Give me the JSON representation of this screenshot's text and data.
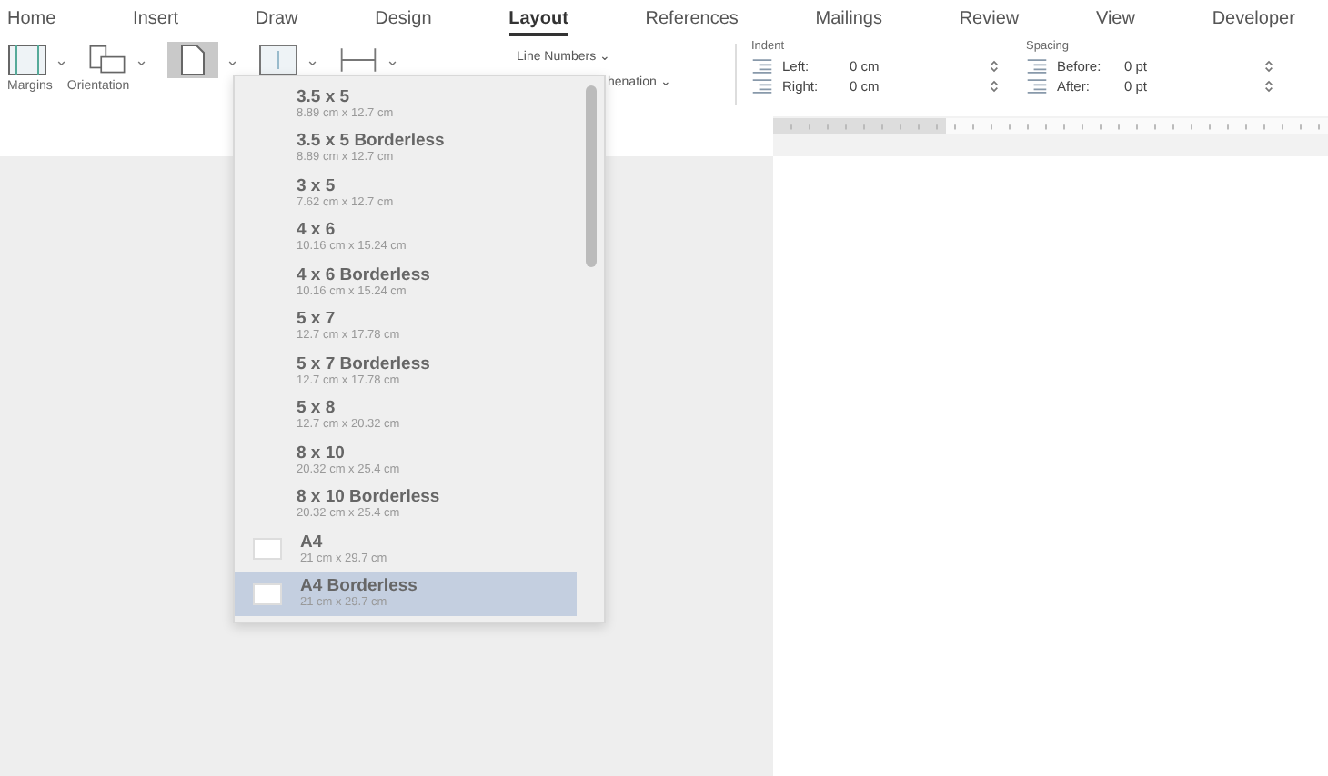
{
  "tabs": [
    {
      "label": "Home",
      "selected": false
    },
    {
      "label": "Insert",
      "selected": false
    },
    {
      "label": "Draw",
      "selected": false
    },
    {
      "label": "Design",
      "selected": false
    },
    {
      "label": "Layout",
      "selected": true
    },
    {
      "label": "References",
      "selected": false
    },
    {
      "label": "Mailings",
      "selected": false
    },
    {
      "label": "Review",
      "selected": false
    },
    {
      "label": "View",
      "selected": false
    },
    {
      "label": "Developer",
      "selected": false
    }
  ],
  "ribbon": {
    "margins_label": "Margins",
    "orientation_label": "Orientation",
    "size_pressed": true,
    "line_numbers": "Line Numbers",
    "hyphenation_partial": "henation",
    "caret": "⌄",
    "indent": {
      "title": "Indent",
      "fields": [
        {
          "label": "Left:",
          "value": "0 cm"
        },
        {
          "label": "Right:",
          "value": "0 cm"
        }
      ]
    },
    "spacing": {
      "title": "Spacing",
      "fields": [
        {
          "label": "Before:",
          "value": "0 pt"
        },
        {
          "label": "After:",
          "value": "0 pt"
        }
      ]
    }
  },
  "size_menu": {
    "items": [
      {
        "name": "3.5 x 5",
        "size": "8.89 cm x 12.7 cm",
        "selected": false,
        "kind": "plain"
      },
      {
        "name": "3.5 x 5 Borderless",
        "size": "8.89 cm x 12.7 cm",
        "selected": false,
        "kind": "plain"
      },
      {
        "name": "3 x 5",
        "size": "7.62 cm x 12.7 cm",
        "selected": false,
        "kind": "plain"
      },
      {
        "name": "4 x 6",
        "size": "10.16 cm x 15.24 cm",
        "selected": false,
        "kind": "plain"
      },
      {
        "name": "4 x 6 Borderless",
        "size": "10.16 cm x 15.24 cm",
        "selected": false,
        "kind": "plain"
      },
      {
        "name": "5 x 7",
        "size": "12.7 cm x 17.78 cm",
        "selected": false,
        "kind": "plain"
      },
      {
        "name": "5 x 7 Borderless",
        "size": "12.7 cm x 17.78 cm",
        "selected": false,
        "kind": "plain"
      },
      {
        "name": "5 x 8",
        "size": "12.7 cm x 20.32 cm",
        "selected": false,
        "kind": "plain"
      },
      {
        "name": "8 x 10",
        "size": "20.32 cm x 25.4 cm",
        "selected": false,
        "kind": "plain"
      },
      {
        "name": "8 x 10 Borderless",
        "size": "20.32 cm x 25.4 cm",
        "selected": false,
        "kind": "plain"
      },
      {
        "name": "A4",
        "size": "21 cm x 29.7 cm",
        "selected": false,
        "kind": "page"
      },
      {
        "name": "A4 Borderless",
        "size": "21 cm x 29.7 cm",
        "selected": true,
        "kind": "page"
      }
    ]
  }
}
